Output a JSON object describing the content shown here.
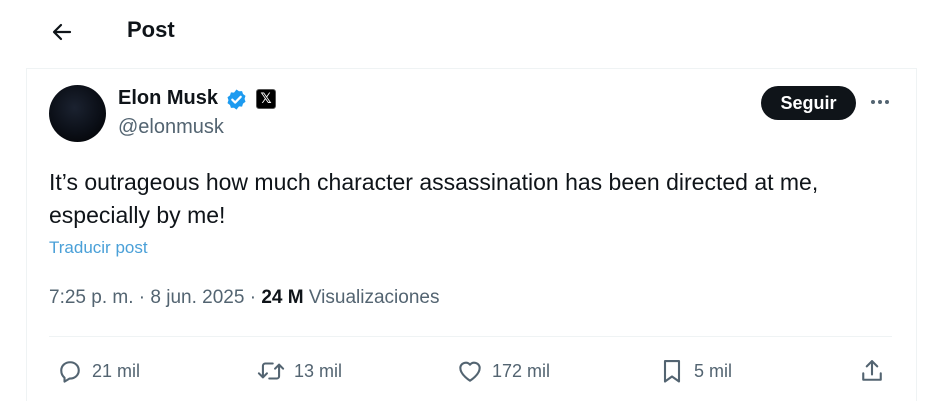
{
  "header": {
    "title": "Post",
    "back_icon": "arrow-left-icon"
  },
  "post": {
    "author_name": "Elon Musk",
    "author_handle": "@elonmusk",
    "verified_icon": "verified-badge-icon",
    "affiliate_badge": "𝕏",
    "follow_label": "Seguir",
    "more_icon": "more-options-icon",
    "text": "It’s outrageous how much character assassination has been directed at me, especially by me!",
    "translate_label": "Traducir post",
    "time": "7:25 p. m.",
    "date": "8 jun. 2025",
    "views_count": "24 M",
    "views_label": "Visualizaciones"
  },
  "actions": {
    "replies": "21 mil",
    "reposts": "13 mil",
    "likes": "172 mil",
    "bookmarks": "5 mil"
  },
  "colors": {
    "text_primary": "#0f1419",
    "text_secondary": "#536471",
    "link": "#4aa0d8",
    "verified": "#1d9bf0",
    "follow_bg": "#0f1419"
  }
}
